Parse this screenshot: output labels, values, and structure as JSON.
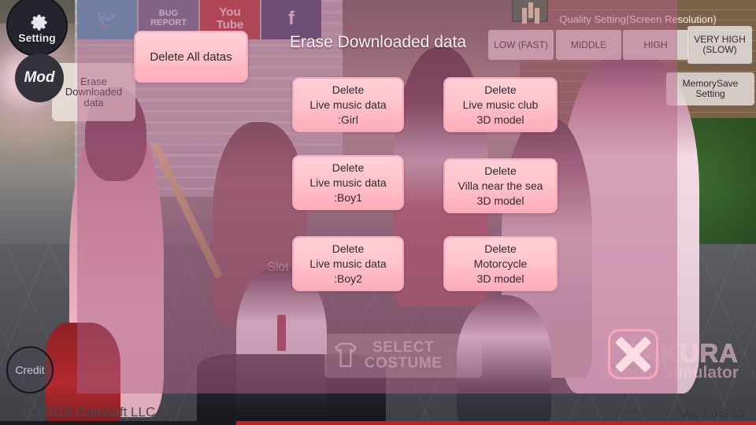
{
  "window": {
    "copyright": "(C)2018 Garusoft LLC",
    "version": "Ver. 1.043.02"
  },
  "corner_controls": {
    "setting_label": "Setting",
    "setting_icon": "gear-icon",
    "mod_label": "Mod",
    "credit_label": "Credit"
  },
  "scene_buttons": {
    "twitter_label": "🐦",
    "bug_report_label": "BUG\nREPORT",
    "youtube_label": "You\nTube",
    "facebook_label": "f",
    "erase_downloaded_label": "Erase\nDownloaded\ndata",
    "select_costume_label": "SELECT\nCOSTUME",
    "slot_label": "Slot"
  },
  "quality_setting": {
    "title": "Quality Setting(Screen Resolution)",
    "options": [
      {
        "label": "LOW (FAST)"
      },
      {
        "label": "MIDDLE"
      },
      {
        "label": "HIGH"
      },
      {
        "label": "VERY HIGH\n(SLOW)"
      }
    ],
    "memory_save_label": "MemorySave\nSetting"
  },
  "dialog": {
    "title": "Erase Downloaded data",
    "delete_all_label": "Delete All datas",
    "close_label": "close",
    "columns": {
      "left": [
        {
          "label": "Delete\nLive music data\n:Girl"
        },
        {
          "label": "Delete\nLive music data\n:Boy1"
        },
        {
          "label": "Delete\nLive music data\n:Boy2"
        }
      ],
      "right": [
        {
          "label": "Delete\nLive music club\n3D model"
        },
        {
          "label": "Delete\nVilla near the sea\n3D model"
        },
        {
          "label": "Delete\nMotorcycle\n3D model"
        }
      ]
    }
  },
  "branding": {
    "logo_line1": "SAKURA",
    "logo_line2": "School Simulator"
  },
  "colors": {
    "button_pink": "#ffc5cd",
    "button_border_pink": "#f6a9b8",
    "overlay_pink": "rgba(205,110,150,.36)",
    "close_x": "#fbdde4"
  }
}
